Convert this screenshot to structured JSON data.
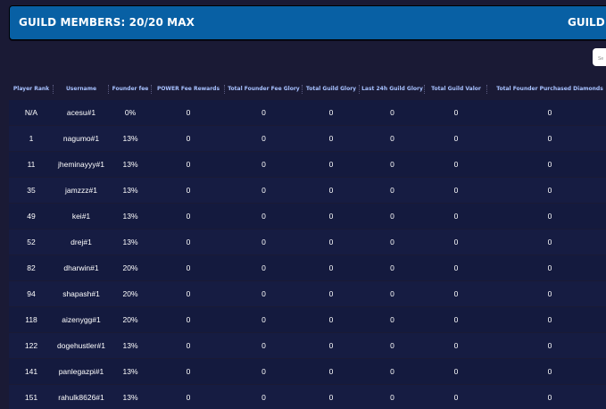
{
  "banner": {
    "title": "GUILD MEMBERS:  20/20 MAX",
    "right_title": "GUILD S"
  },
  "search": {
    "placeholder": "Se"
  },
  "table": {
    "columns": [
      "Player Rank",
      "Username",
      "Founder fee",
      "POWER Fee Rewards",
      "Total Founder Fee Glory",
      "Total Guild Glory",
      "Last 24h Guild Glory",
      "Total Guild Valor",
      "Total Founder Purchased Diamonds"
    ],
    "rows": [
      [
        "N/A",
        "acesu#1",
        "0%",
        "0",
        "0",
        "0",
        "0",
        "0",
        "0"
      ],
      [
        "1",
        "nagumo#1",
        "13%",
        "0",
        "0",
        "0",
        "0",
        "0",
        "0"
      ],
      [
        "11",
        "jheminayyy#1",
        "13%",
        "0",
        "0",
        "0",
        "0",
        "0",
        "0"
      ],
      [
        "35",
        "jamzzz#1",
        "13%",
        "0",
        "0",
        "0",
        "0",
        "0",
        "0"
      ],
      [
        "49",
        "kei#1",
        "13%",
        "0",
        "0",
        "0",
        "0",
        "0",
        "0"
      ],
      [
        "52",
        "drej#1",
        "13%",
        "0",
        "0",
        "0",
        "0",
        "0",
        "0"
      ],
      [
        "82",
        "dharwin#1",
        "20%",
        "0",
        "0",
        "0",
        "0",
        "0",
        "0"
      ],
      [
        "94",
        "shapash#1",
        "20%",
        "0",
        "0",
        "0",
        "0",
        "0",
        "0"
      ],
      [
        "118",
        "aizenygg#1",
        "20%",
        "0",
        "0",
        "0",
        "0",
        "0",
        "0"
      ],
      [
        "122",
        "dogehustler#1",
        "13%",
        "0",
        "0",
        "0",
        "0",
        "0",
        "0"
      ],
      [
        "141",
        "panlegazpi#1",
        "13%",
        "0",
        "0",
        "0",
        "0",
        "0",
        "0"
      ],
      [
        "151",
        "rahulk8626#1",
        "13%",
        "0",
        "0",
        "0",
        "0",
        "0",
        "0"
      ]
    ]
  },
  "colors": {
    "page_background": "#1a1a35",
    "banner_background": "#0860a4",
    "header_text": "#a7c1ff",
    "row_background": "#141a3e",
    "cell_text": "#ffffff"
  }
}
